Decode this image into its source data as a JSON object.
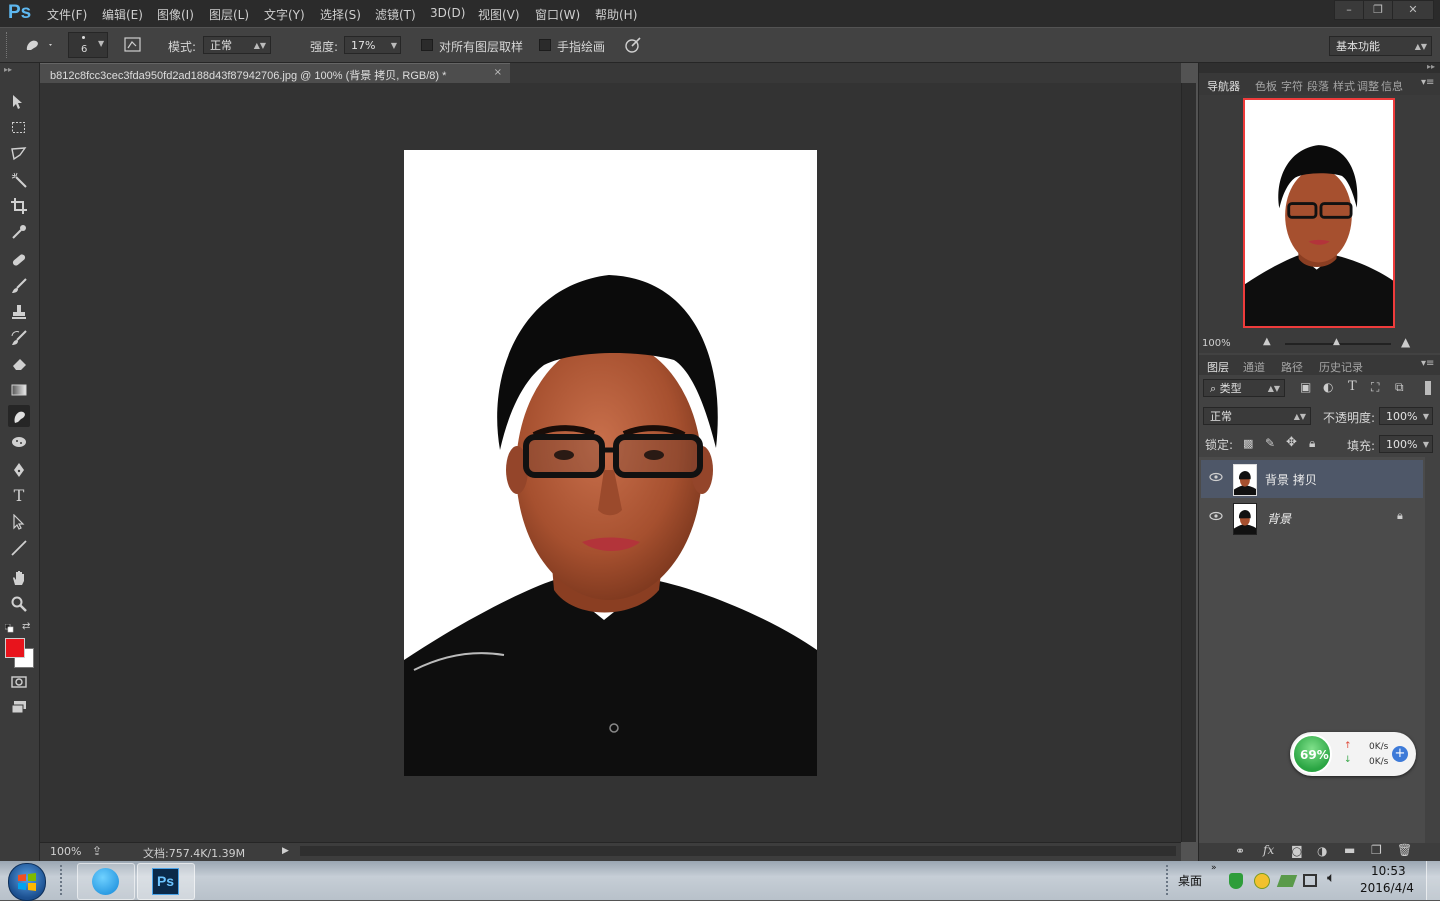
{
  "app": {
    "logo": "Ps"
  },
  "menu": {
    "items": [
      "文件(F)",
      "编辑(E)",
      "图像(I)",
      "图层(L)",
      "文字(Y)",
      "选择(S)",
      "滤镜(T)",
      "3D(D)",
      "视图(V)",
      "窗口(W)",
      "帮助(H)"
    ]
  },
  "window_controls": {
    "minimize": "–",
    "restore": "❐",
    "close": "✕"
  },
  "options": {
    "brush_size": "6",
    "mode_label": "模式:",
    "mode_value": "正常",
    "strength_label": "强度:",
    "strength_value": "17%",
    "sample_all_label": "对所有图层取样",
    "finger_paint_label": "手指绘画",
    "workspace": "基本功能"
  },
  "document": {
    "tab_title": "b812c8fcc3cec3fda950fd2ad188d43f87942706.jpg @ 100% (背景 拷贝, RGB/8) *",
    "close": "×"
  },
  "status": {
    "zoom": "100%",
    "doc_info": "文档:757.4K/1.39M"
  },
  "colors": {
    "foreground": "#e8141c",
    "background": "#ffffff",
    "accent_nav_frame": "#ee3b3b",
    "selected_layer": "#4e5768"
  },
  "navigator": {
    "tabs": [
      "导航器",
      "色板",
      "字符",
      "段落",
      "样式",
      "调整",
      "信息"
    ],
    "zoom": "100%"
  },
  "layers_panel": {
    "tabs": [
      "图层",
      "通道",
      "路径",
      "历史记录"
    ],
    "filter_label": "类型",
    "blend_mode": "正常",
    "opacity_label": "不透明度:",
    "opacity_value": "100%",
    "lock_label": "锁定:",
    "fill_label": "填充:",
    "fill_value": "100%",
    "layers": [
      {
        "name": "背景 拷贝",
        "selected": true
      },
      {
        "name": "背景",
        "selected": false,
        "locked": true
      }
    ]
  },
  "net_widget": {
    "percent": "69%",
    "up": "0K/s",
    "down": "0K/s"
  },
  "taskbar": {
    "desktop_label": "桌面",
    "time": "10:53",
    "date": "2016/4/4",
    "ps_label": "Ps"
  }
}
